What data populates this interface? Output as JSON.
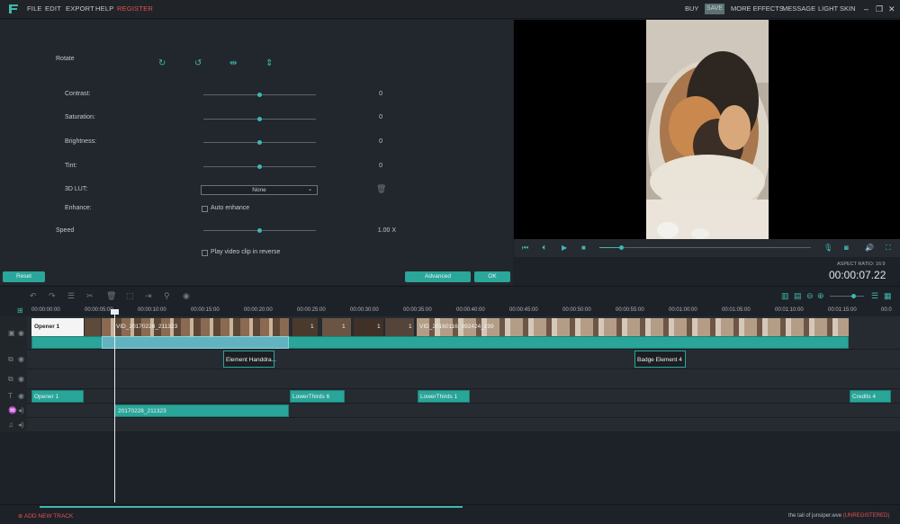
{
  "menu": {
    "items": [
      "FILE",
      "EDIT",
      "EXPORT",
      "HELP",
      "REGISTER"
    ],
    "right": [
      "BUY",
      "SAVE",
      "MORE EFFECTS",
      "MESSAGE",
      "LIGHT SKIN"
    ]
  },
  "editor": {
    "rotate_label": "Rotate",
    "contrast_label": "Contrast:",
    "contrast_value": "0",
    "saturation_label": "Saturation:",
    "saturation_value": "0",
    "brightness_label": "Brightness:",
    "brightness_value": "0",
    "tint_label": "Tint:",
    "tint_value": "0",
    "lut_label": "3D LUT:",
    "lut_value": "None",
    "enhance_label": "Enhance:",
    "auto_enhance_label": "Auto enhance",
    "speed_label": "Speed",
    "speed_value": "1.00 X",
    "reverse_label": "Play video clip in reverse",
    "reset_label": "Reset",
    "advanced_label": "Advanced",
    "ok_label": "OK"
  },
  "preview": {
    "progress": 0.1,
    "aspect_ratio": "ASPECT RATIO: 16:9",
    "timecode": "00:00:07.22"
  },
  "timeline": {
    "ruler": [
      "00:00:00:00",
      "00:00:05:00",
      "00:00:10:00",
      "00:00:15:00",
      "00:00:20:00",
      "00:00:25:00",
      "00:00:30:00",
      "00:00:35:00",
      "00:00:40:00",
      "00:00:45:00",
      "00:00:50:00",
      "00:00:55:00",
      "00:01:00:00",
      "00:01:05:00",
      "00:01:10:00",
      "00:01:15:00",
      "00:0"
    ],
    "clips": {
      "opener_video": "Opener 1",
      "video_file": "VID_20170228_211323",
      "video_file2": "VID_20160116_092424_199",
      "num1": "1",
      "num2": "1",
      "num3": "1",
      "num4": "1",
      "element1": "Element Handdra...",
      "element2": "Badge Element 4",
      "title1": "Opener 1",
      "title2": "LowerThirds 6",
      "title3": "LowerThirds 1",
      "title4": "Credits 4",
      "audio": "20170228_211323"
    }
  },
  "bottom": {
    "add_track": "ADD NEW TRACK",
    "project_name": "the tail of junsiper.wve",
    "unregistered": "(UNREGISTERED)"
  }
}
